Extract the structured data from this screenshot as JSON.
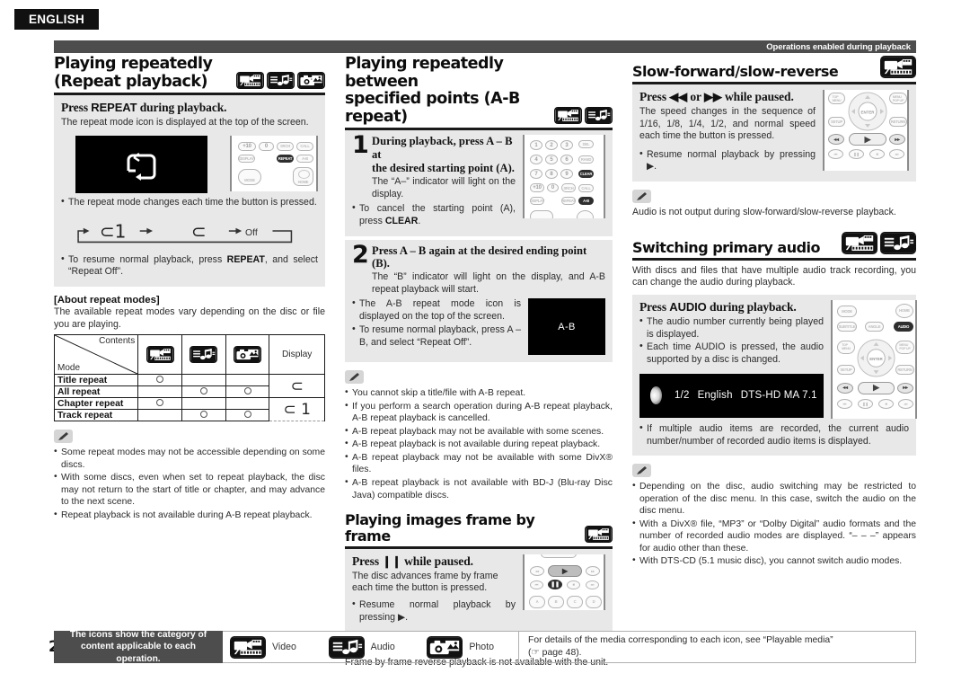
{
  "language_tag": "ENGLISH",
  "top_bar": {
    "label": "Operations enabled during playback"
  },
  "page_number": "22",
  "columns": {
    "col1": {
      "heading": "Playing repeatedly (Repeat playback)",
      "heading_line1": "Playing repeatedly",
      "heading_line2": "(Repeat playback)",
      "icons": [
        "video-icon",
        "audio-icon",
        "photo-icon"
      ],
      "instruction_title_pre": "Press ",
      "instruction_title_key": "REPEAT",
      "instruction_title_post": " during playback.",
      "instruction_text": "The repeat mode icon is displayed at the top of the screen.",
      "osd_icon_label": "repeat-chapter-glyph",
      "bullet_change": "The repeat mode changes each time the button is pressed.",
      "cycle": {
        "item1": "⊂ 1",
        "item2": "⊂",
        "item3": "Off"
      },
      "bullet_resume_pre": "To resume normal playback, press ",
      "bullet_resume_key": "REPEAT",
      "bullet_resume_post": ", and select “Repeat Off”.",
      "about_title": "[About repeat modes]",
      "about_text": "The available repeat modes vary depending on the disc or file you are playing.",
      "table": {
        "header_contents": "Contents",
        "header_mode": "Mode",
        "header_display": "Display",
        "header_icons": [
          "video-icon",
          "audio-icon",
          "photo-icon"
        ],
        "rows": [
          {
            "mode": "Title repeat",
            "video": true,
            "audio": false,
            "photo": false,
            "display": "⊂"
          },
          {
            "mode": "All repeat",
            "video": false,
            "audio": true,
            "photo": true,
            "display": ""
          },
          {
            "mode": "Chapter repeat",
            "video": true,
            "audio": false,
            "photo": false,
            "display": "⊂ 1"
          },
          {
            "mode": "Track repeat",
            "video": false,
            "audio": true,
            "photo": true,
            "display": ""
          }
        ],
        "display_group1": "⊂",
        "display_group2": "⊂ 1"
      },
      "notes": [
        "Some repeat modes may not be accessible depending on some discs.",
        "With some discs, even when set to repeat playback, the disc may not return to the start of title or chapter, and may advance to the next scene.",
        "Repeat playback is not available during A-B repeat playback."
      ]
    },
    "col2": {
      "heading_line1": "Playing repeatedly between",
      "heading_line2": "specified points (A-B repeat)",
      "icons": [
        "video-icon",
        "audio-icon"
      ],
      "step1": {
        "number": "1",
        "head_line1": "During playback, press A – B at",
        "head_line2": "the desired starting point (A).",
        "text": "The “A–” indicator will light on the display.",
        "bullet_pre": "To cancel the starting point (A), press ",
        "bullet_key": "CLEAR",
        "bullet_post": "."
      },
      "step2": {
        "number": "2",
        "head": "Press A – B again at the desired ending point (B).",
        "text": "The “B” indicator will light on the display, and A-B repeat playback will start.",
        "bullets": [
          "The A-B repeat mode icon is displayed on the top of the screen.",
          "To resume normal playback, press A – B, and select “Repeat Off”."
        ],
        "osd_label": "A-B"
      },
      "notes": [
        "You cannot skip a title/file with A-B repeat.",
        "If you perform a search operation during A-B repeat playback, A-B repeat playback is cancelled.",
        "A-B repeat playback may not be available with some scenes.",
        "A-B repeat playback is not available during repeat playback.",
        "A-B repeat playback may not be available with some DivX® files.",
        "A-B repeat playback is not available with BD-J (Blu-ray Disc Java) compatible discs."
      ],
      "frame_section": {
        "heading": "Playing images frame by frame",
        "icons": [
          "video-icon"
        ],
        "title_pre": "Press ",
        "title_key": "❙❙",
        "title_post": " while paused.",
        "text": "The disc advances frame by frame each time the button is pressed.",
        "bullet": "Resume normal playback by pressing ▶.",
        "note": "Frame by frame reverse playback is not available with the unit."
      }
    },
    "col3": {
      "slow_section": {
        "heading": "Slow-forward/slow-reverse",
        "icons": [
          "video-icon"
        ],
        "title_pre": "Press ",
        "title_key1": "◀◀",
        "title_mid": " or ",
        "title_key2": "▶▶",
        "title_post": " while paused.",
        "text": "The speed changes in the sequence of 1/16, 1/8, 1/4, 1/2, and normal speed each time the button is pressed.",
        "bullet": "Resume normal playback by pressing ▶.",
        "note": "Audio is not output during slow-forward/slow-reverse playback."
      },
      "audio_section": {
        "heading": "Switching primary audio",
        "icons": [
          "video-icon",
          "audio-icon"
        ],
        "intro": "With discs and files that have multiple audio track recording, you can change the audio during playback.",
        "title_pre": "Press ",
        "title_key": "AUDIO",
        "title_post": " during playback.",
        "bullets": [
          "The audio number currently being played is displayed.",
          "Each time AUDIO is pressed, the audio supported by a disc is changed."
        ],
        "osd": {
          "track": "1/2",
          "language": "English",
          "format": "DTS-HD MA 7.1"
        },
        "bullet_after": "If multiple audio items are recorded, the current audio number/number of recorded audio items is displayed.",
        "notes": [
          "Depending on the disc, audio switching may be restricted to operation of the disc menu. In this case, switch the audio on the disc menu.",
          "With a DivX® file, “MP3” or “Dolby Digital” audio formats and the number of recorded audio modes are displayed. “– – –” appears for audio other than these.",
          "With DTS-CD (5.1 music disc), you cannot switch audio modes."
        ]
      }
    }
  },
  "footer": {
    "legend_line1": "The icons show the category of",
    "legend_line2": "content applicable to each operation.",
    "icons": [
      {
        "name": "video-icon",
        "label": "Video"
      },
      {
        "name": "audio-icon",
        "label": "Audio"
      },
      {
        "name": "photo-icon",
        "label": "Photo"
      }
    ],
    "note_line1": "For details of the media corresponding to each icon, see “Playable media”",
    "note_line2": "(☞ page 48)."
  },
  "remote_keys": {
    "repeat_remote": [
      "+10",
      "0",
      "SRCH",
      "CALL",
      "DISPLAY",
      "REPEAT",
      "A-B",
      "MODE",
      "HOME"
    ],
    "ab_remote": [
      "1",
      "2",
      "3",
      "DEL",
      "4",
      "5",
      "6",
      "RAND",
      "7",
      "8",
      "9",
      "CLEAR",
      "+10",
      "0",
      "SRCH",
      "CALL",
      "DISPLAY",
      "REPEAT",
      "A-B"
    ],
    "transport_remote": [
      "◀◀",
      "▶",
      "▶▶",
      "⏮",
      "❙❙",
      "■",
      "⏭"
    ],
    "audio_remote": [
      "MODE",
      "HOME",
      "SUBTITLE",
      "ANGLE",
      "AUDIO",
      "TOP MENU",
      "ENTER",
      "MENU",
      "SETUP",
      "RETURN"
    ]
  },
  "colors": {
    "bar_gray": "#4d4d4d",
    "panel_gray": "#e8e8e8",
    "black": "#111111",
    "osd_black": "#000000"
  }
}
